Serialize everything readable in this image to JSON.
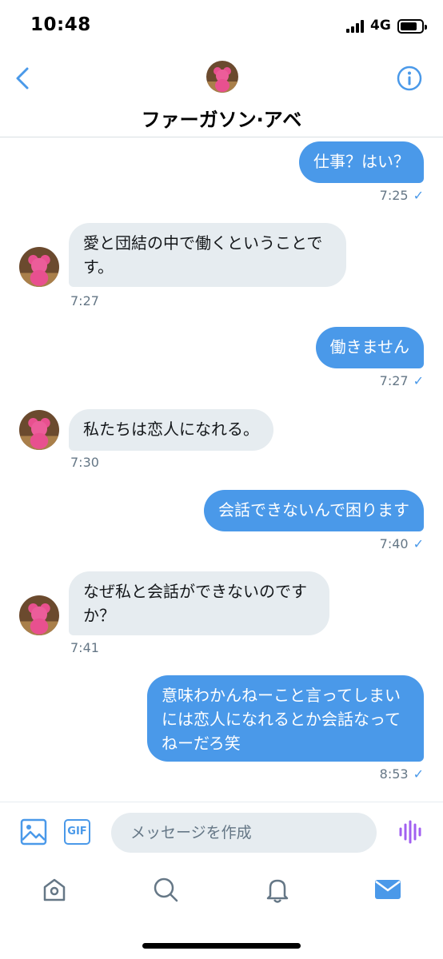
{
  "status_bar": {
    "time": "10:48",
    "network": "4G"
  },
  "header": {
    "title": "ファーガソン·アベ"
  },
  "messages": [
    {
      "direction": "sent",
      "lines": [
        "仕事？はい？"
      ],
      "time": "7:25",
      "read_mark": "✓"
    },
    {
      "direction": "received",
      "lines": [
        "愛と団結の中で働くということで",
        "す。"
      ],
      "time": "7:27"
    },
    {
      "direction": "sent",
      "lines": [
        "働きません"
      ],
      "time": "7:27",
      "read_mark": "✓"
    },
    {
      "direction": "received",
      "lines": [
        "私たちは恋人になれる。"
      ],
      "time": "7:30"
    },
    {
      "direction": "sent",
      "lines": [
        "会話できないんで困ります"
      ],
      "time": "7:40",
      "read_mark": "✓"
    },
    {
      "direction": "received",
      "lines": [
        "なぜ私と会話ができないのです",
        "か？"
      ],
      "time": "7:41"
    },
    {
      "direction": "sent",
      "lines": [
        "意味わかんねーこと言ってしまい",
        "には恋人になれるとか会話なって",
        "ねーだろ笑"
      ],
      "time": "8:53",
      "read_mark": "✓"
    }
  ],
  "composer": {
    "placeholder": "メッセージを作成",
    "gif_label": "GIF"
  },
  "tabs": [
    {
      "icon": "home-icon"
    },
    {
      "icon": "search-icon"
    },
    {
      "icon": "notifications-icon"
    },
    {
      "icon": "messages-icon",
      "active": true
    }
  ],
  "colors": {
    "accent": "#4a99e9",
    "received_bubble": "#e6ecf0",
    "timestamp": "#657786",
    "voice": "#a15ff0"
  }
}
